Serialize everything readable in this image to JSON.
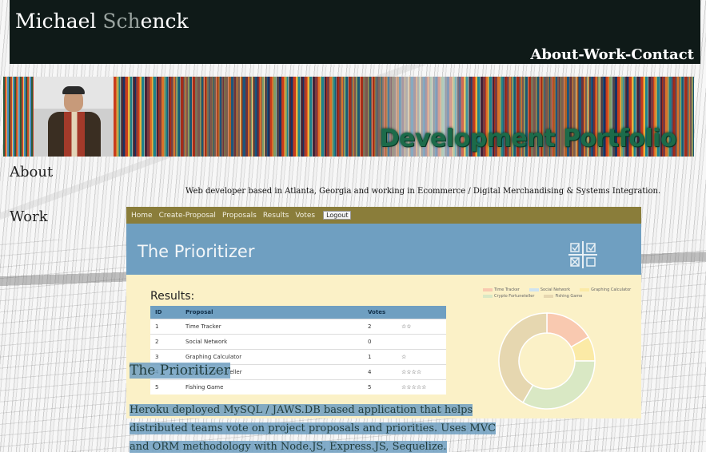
{
  "header": {
    "brand_first": "Michael ",
    "brand_sch": "Sch",
    "brand_rest": "enck",
    "nav": [
      "About",
      "-Work",
      "-Contact"
    ]
  },
  "banner": {
    "title": "Development Portfolio"
  },
  "sections": {
    "about_heading": "About",
    "intro": "Web developer based in Atlanta, Georgia and working in Ecommerce / Digital Merchandising & Systems Integration.",
    "work_heading": "Work"
  },
  "project": {
    "nav": [
      "Home",
      "Create-Proposal",
      "Proposals",
      "Results",
      "Votes"
    ],
    "logout": "Logout",
    "hero_title": "The Prioritizer",
    "results_label": "Results:",
    "table_headers": [
      "ID",
      "Proposal",
      "Votes",
      ""
    ],
    "rows": [
      {
        "id": "1",
        "proposal": "Time Tracker",
        "votes": "2",
        "stars": "☆☆"
      },
      {
        "id": "2",
        "proposal": "Social Network",
        "votes": "0",
        "stars": ""
      },
      {
        "id": "3",
        "proposal": "Graphing Calculator",
        "votes": "1",
        "stars": "☆"
      },
      {
        "id": "4",
        "proposal": "Crypto Fortuneteller",
        "votes": "4",
        "stars": "☆☆☆☆"
      },
      {
        "id": "5",
        "proposal": "Fishing Game",
        "votes": "5",
        "stars": "☆☆☆☆☆"
      }
    ],
    "legend": [
      {
        "label": "Time Tracker",
        "color": "#f9c9b0"
      },
      {
        "label": "Social Network",
        "color": "#cfe3f0"
      },
      {
        "label": "Graphing Calculator",
        "color": "#fbeaa6"
      },
      {
        "label": "Crypto Fortuneteller",
        "color": "#d9e8c4"
      },
      {
        "label": "Fishing Game",
        "color": "#e6d7b0"
      }
    ],
    "caption_title": "The Prioritizer",
    "description_lines": [
      "Heroku deployed MySQL / JAWS.DB based application that helps",
      "distributed teams vote on project proposals and priorities. Uses MVC",
      "and ORM methodology with Node.JS, Express.JS, Sequelize."
    ]
  },
  "chart_data": {
    "type": "pie",
    "categories": [
      "Time Tracker",
      "Social Network",
      "Graphing Calculator",
      "Crypto Fortuneteller",
      "Fishing Game"
    ],
    "values": [
      2,
      0,
      1,
      4,
      5
    ],
    "title": ""
  }
}
